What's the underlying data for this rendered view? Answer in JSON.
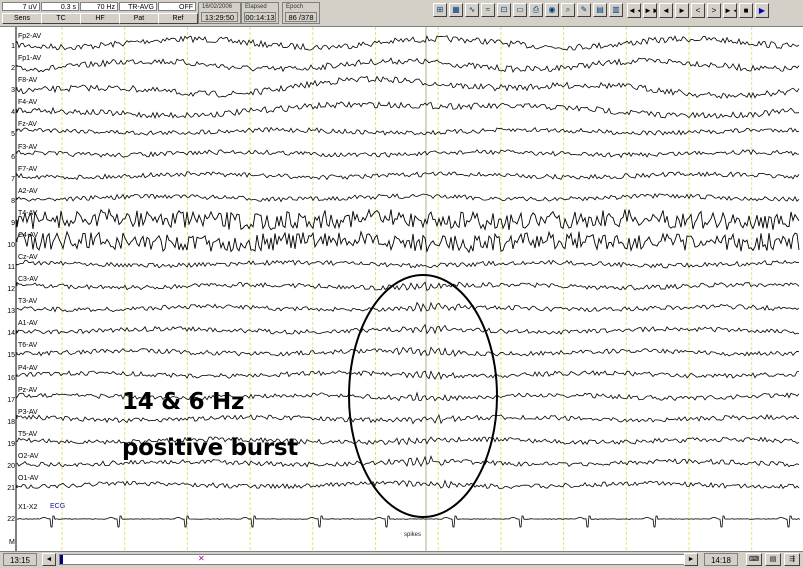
{
  "settings": [
    {
      "value": "7 uV",
      "label": "Sens"
    },
    {
      "value": "0.3 s",
      "label": "TC"
    },
    {
      "value": "70 Hz",
      "label": "HF"
    },
    {
      "value": "TR-AVG",
      "label": "Pat"
    },
    {
      "value": "OFF",
      "label": "Ref"
    }
  ],
  "info": {
    "date": "16/02/2006",
    "time": "13:29:50",
    "elapsed_label": "Elapsed",
    "elapsed": "00:14:13",
    "epoch_label": "Epoch",
    "epoch": "86 /378"
  },
  "tool_icons": [
    "montage-icon",
    "filter-icon",
    "spectrum-icon",
    "wave-icon",
    "measure-icon",
    "report-icon",
    "print-icon",
    "camera-icon",
    "zoom-icon",
    "pen-icon",
    "grid-icon",
    "table-icon"
  ],
  "nav_buttons": [
    {
      "name": "fast-back-button",
      "glyph": "◄◄"
    },
    {
      "name": "fast-forward-button",
      "glyph": "►►"
    },
    {
      "name": "step-back-button",
      "glyph": "◄"
    },
    {
      "name": "step-forward-button",
      "glyph": "►"
    },
    {
      "name": "page-back-button",
      "glyph": "<"
    },
    {
      "name": "page-forward-button",
      "glyph": ">"
    },
    {
      "name": "fit-button",
      "glyph": "►◄"
    },
    {
      "name": "stop-button",
      "glyph": "■"
    },
    {
      "name": "play-button",
      "glyph": "▶"
    }
  ],
  "channels": [
    {
      "num": "1",
      "name": "Fp2-AV"
    },
    {
      "num": "2",
      "name": "Fp1-AV"
    },
    {
      "num": "3",
      "name": "F8-AV"
    },
    {
      "num": "4",
      "name": "F4-AV"
    },
    {
      "num": "5",
      "name": "Fz-AV"
    },
    {
      "num": "6",
      "name": "F3-AV"
    },
    {
      "num": "7",
      "name": "F7-AV"
    },
    {
      "num": "8",
      "name": "A2-AV"
    },
    {
      "num": "9",
      "name": "T4-AV"
    },
    {
      "num": "10",
      "name": "C4-AV"
    },
    {
      "num": "11",
      "name": "Cz-AV"
    },
    {
      "num": "12",
      "name": "C3-AV"
    },
    {
      "num": "13",
      "name": "T3-AV"
    },
    {
      "num": "14",
      "name": "A1-AV"
    },
    {
      "num": "15",
      "name": "T6-AV"
    },
    {
      "num": "16",
      "name": "P4-AV"
    },
    {
      "num": "17",
      "name": "Pz-AV"
    },
    {
      "num": "18",
      "name": "P3-AV"
    },
    {
      "num": "19",
      "name": "T5-AV"
    },
    {
      "num": "20",
      "name": "O2-AV"
    },
    {
      "num": "21",
      "name": "O1-AV"
    }
  ],
  "ecg": {
    "num": "22",
    "name": "X1-X2",
    "type": "ECG"
  },
  "marker_label": "M",
  "spikes_label": "spikes",
  "annotation": {
    "line1": "14 & 6 Hz",
    "line2": "positive burst"
  },
  "footer": {
    "start_time": "13:15",
    "end_time": "14:18",
    "marker_glyph": "✕",
    "left_arrow": "◄",
    "right_arrow": "►"
  },
  "colors": {
    "grid": "#e8e070",
    "trace": "#000000",
    "ecg_label": "#1010a0",
    "window_bg": "#d4d0c8"
  }
}
